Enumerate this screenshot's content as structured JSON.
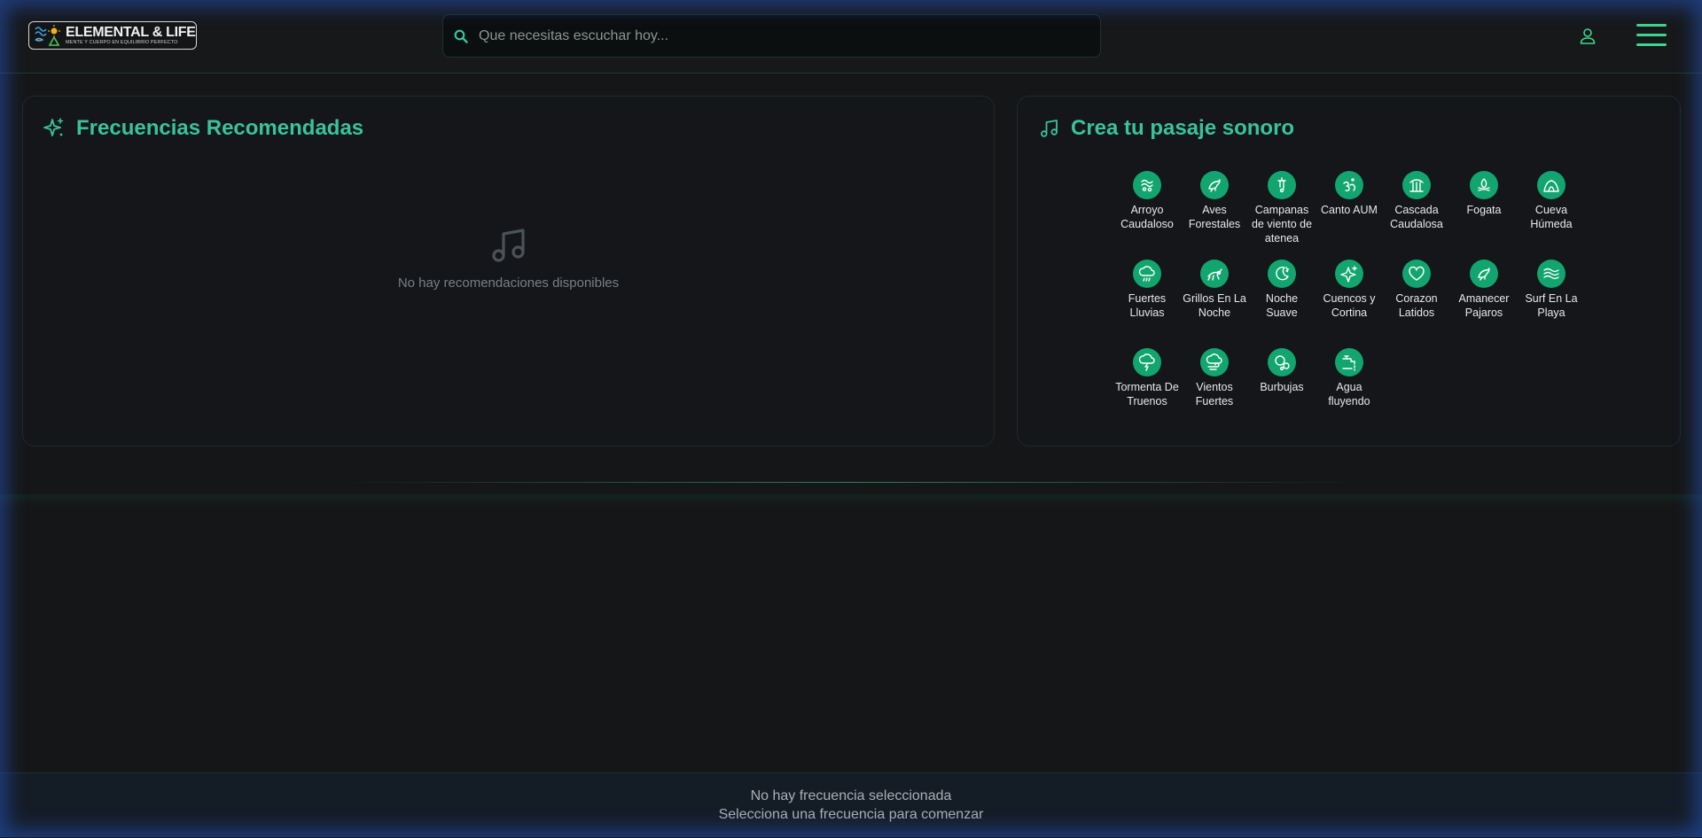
{
  "header": {
    "logo_title": "ELEMENTAL & LIFE",
    "logo_subtitle": "MENTE Y CUERPO EN EQUILIBRIO PERFECTO",
    "search_placeholder": "Que necesitas escuchar hoy...",
    "search_value": ""
  },
  "recommended": {
    "title": "Frecuencias Recomendadas",
    "empty_text": "No hay recomendaciones disponibles"
  },
  "soundscape": {
    "title": "Crea tu pasaje sonoro",
    "items": [
      {
        "label": "Arroyo Caudaloso",
        "icon": "stream-icon"
      },
      {
        "label": "Aves Forestales",
        "icon": "bird-icon"
      },
      {
        "label": "Campanas de viento de atenea",
        "icon": "wind-chimes-icon"
      },
      {
        "label": "Canto AUM",
        "icon": "om-icon"
      },
      {
        "label": "Cascada Caudalosa",
        "icon": "waterfall-icon"
      },
      {
        "label": "Fogata",
        "icon": "campfire-icon"
      },
      {
        "label": "Cueva Húmeda",
        "icon": "cave-icon"
      },
      {
        "label": "Fuertes Lluvias",
        "icon": "rain-cloud-icon"
      },
      {
        "label": "Grillos En La Noche",
        "icon": "cricket-icon"
      },
      {
        "label": "Noche Suave",
        "icon": "moon-icon"
      },
      {
        "label": "Cuencos y Cortina",
        "icon": "sparkle-icon"
      },
      {
        "label": "Corazon Latidos",
        "icon": "heart-icon"
      },
      {
        "label": "Amanecer Pajaros",
        "icon": "bird-icon"
      },
      {
        "label": "Surf En La Playa",
        "icon": "waves-icon"
      },
      {
        "label": "Tormenta De Truenos",
        "icon": "storm-icon"
      },
      {
        "label": "Vientos Fuertes",
        "icon": "wind-cloud-icon"
      },
      {
        "label": "Burbujas",
        "icon": "bubbles-icon"
      },
      {
        "label": "Agua fluyendo",
        "icon": "faucet-icon"
      }
    ]
  },
  "player": {
    "line1": "No hay frecuencia seleccionada",
    "line2": "Selecciona una frecuencia para comenzar"
  },
  "colors": {
    "accent": "#3ac39a",
    "icon_bg": "#12a56f",
    "menu": "#3dd68c",
    "background": "#151617"
  }
}
